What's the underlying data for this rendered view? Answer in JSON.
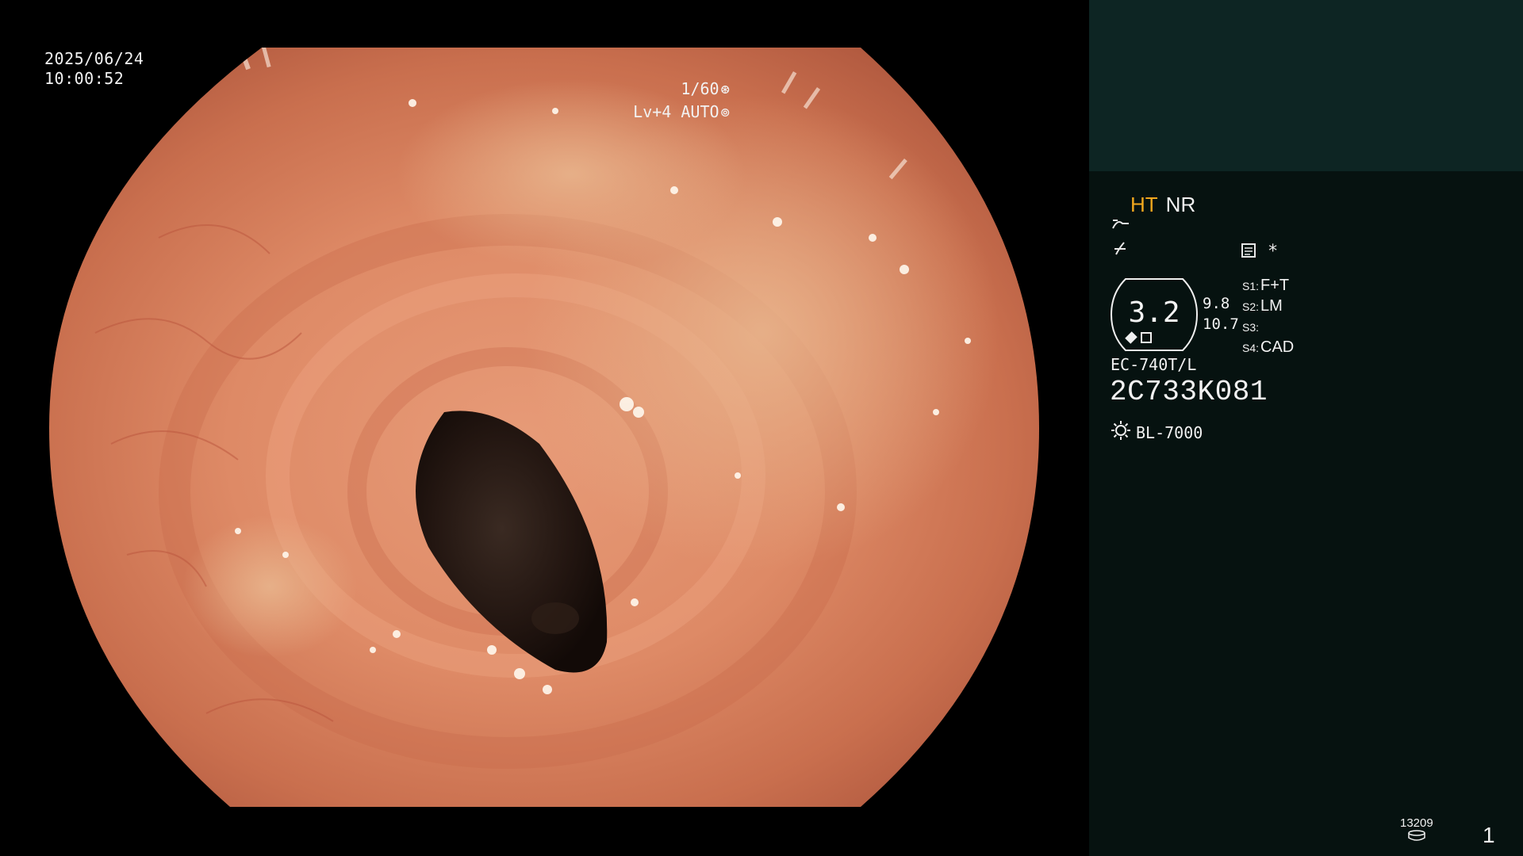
{
  "overlay": {
    "date": "2025/06/24",
    "time": "10:00:52",
    "shutter": "1/60",
    "shutter_icon": "aperture-icon",
    "level": "Lv+4 AUTO",
    "auto_icon": "iris-icon"
  },
  "panel": {
    "mode_ht": "HT",
    "mode_nr": "NR",
    "colors": {
      "ht": "#f2a81e",
      "panel_bg": "#061210",
      "panel_top_bg": "#0d2523"
    },
    "zoom_value": "3.2",
    "value_top": "9.8",
    "value_bottom": "10.7",
    "star": "*",
    "scopes": [
      {
        "key": "S1:",
        "value": "F+T"
      },
      {
        "key": "S2:",
        "value": "LM"
      },
      {
        "key": "S3:",
        "value": ""
      },
      {
        "key": "S4:",
        "value": "CAD"
      }
    ],
    "model": "EC-740T/L",
    "serial": "2C733K081",
    "light_source": "BL-7000",
    "light_icon": "sun-icon",
    "counter": "13209",
    "counter_icon": "storage-icon",
    "page_number": "1"
  }
}
